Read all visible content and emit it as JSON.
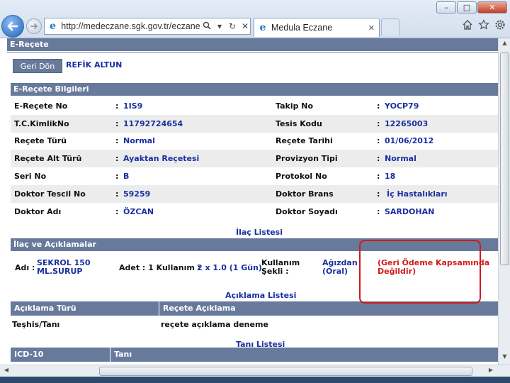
{
  "browser": {
    "url": "http://medeczane.sgk.gov.tr/eczane/faces/",
    "tab_title": "Medula Eczane",
    "window_buttons": {
      "minimize": "–",
      "maximize": "□",
      "close": "✕"
    },
    "icons": {
      "back": "arrow-left-icon",
      "forward": "arrow-right-icon",
      "search": "search-icon",
      "dropdown": "chevron-down-icon",
      "refresh": "refresh-icon",
      "stop": "stop-icon",
      "home": "home-icon",
      "favorites": "star-icon",
      "tools": "gear-icon"
    }
  },
  "page": {
    "title": "E-Reçete",
    "back_button": "Geri Dön",
    "patient_name": "REFİK ALTUN",
    "info_section_title": "E-Reçete Bilgileri",
    "info_rows": [
      {
        "l1": "E-Reçete No",
        "v1": "1IS9",
        "l2": "Takip No",
        "v2": "YOCP79"
      },
      {
        "l1": "T.C.KimlikNo",
        "v1": "11792724654",
        "l2": "Tesis Kodu",
        "v2": "12265003"
      },
      {
        "l1": "Reçete Türü",
        "v1": "Normal",
        "l2": "Reçete Tarihi",
        "v2": "01/06/2012"
      },
      {
        "l1": "Reçete Alt Türü",
        "v1": "Ayaktan Reçetesi",
        "l2": "Provizyon Tipi",
        "v2": "Normal"
      },
      {
        "l1": "Seri No",
        "v1": "B",
        "l2": "Protokol No",
        "v2": "18"
      },
      {
        "l1": "Doktor Tescil No",
        "v1": "59259",
        "l2": "Doktor Brans",
        "v2": "İç Hastalıkları"
      },
      {
        "l1": "Doktor Adı",
        "v1": "ÖZCAN",
        "l2": "Doktor Soyadı",
        "v2": "SARDOHAN"
      }
    ],
    "colon": ":",
    "drug_list_title": "İlaç Listesi",
    "drug_section_title": "İlaç ve Açıklamalar",
    "drug": {
      "name_label": "Adı :",
      "name_line1": "SEKROL 150",
      "name_line2": "ML.SURUP",
      "dose_label": "Adet : 1 Kullanım :",
      "dose_value": "2 x 1.0 (1 Gün)",
      "usage_label_line1": "Kullanım",
      "usage_label_line2": "Şekli :",
      "usage_value_line1": "Ağızdan",
      "usage_value_line2": "(Oral)",
      "warning_line1": "(Geri Ödeme Kapsamında",
      "warning_line2": "Değildir)"
    },
    "explanation_list_title": "Açıklama Listesi",
    "explanation_table": {
      "headers": [
        "Açıklama Türü",
        "Reçete Açıklama"
      ],
      "rows": [
        {
          "type": "Teşhis/Tanı",
          "text": "reçete açıklama deneme"
        }
      ]
    },
    "diagnosis_list_title": "Tanı Listesi",
    "diagnosis_table": {
      "headers": [
        "ICD-10",
        "Tanı"
      ]
    }
  },
  "colors": {
    "header": "#687a9c",
    "value_blue": "#1a2fa0",
    "warning_red": "#d11a1a",
    "row_shade": "#ececec"
  }
}
